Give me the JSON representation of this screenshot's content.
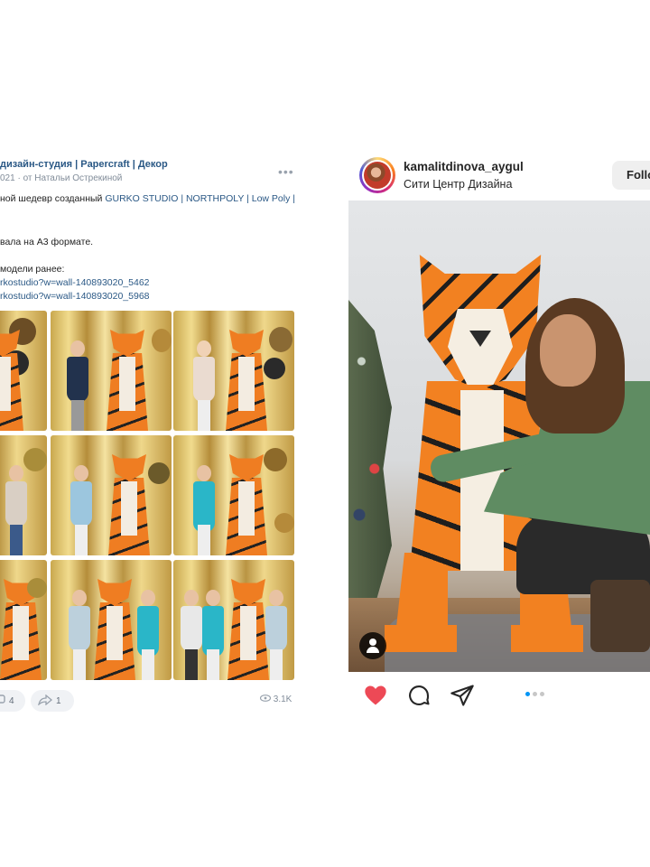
{
  "vk_post": {
    "title": "дизайн-студия | Papercraft | Декор",
    "subtitle": "021 · от Натальи Острекиной",
    "text_line1_prefix": "ной шедевр созданный ",
    "text_line1_link": "GURKO STUDIO | NORTHPOLY | Low Poly |",
    "text_line2": "вала на А3 формате.",
    "text_line3": "модели ранее:",
    "link1": "rkostudio?w=wall-140893020_5462",
    "link2": "rkostudio?w=wall-140893020_5968",
    "comments_count": "4",
    "shares_count": "1",
    "views": "3.1K",
    "icons": {
      "more": "more-dots-icon",
      "comment": "comment-icon",
      "share": "share-icon",
      "views": "eye-icon"
    }
  },
  "instagram_post": {
    "username": "kamalitdinova_aygul",
    "location": "Сити Центр Дизайна",
    "follow_label": "Follow",
    "carousel_total": 3,
    "carousel_active": 1,
    "colors": {
      "like": "#ed4956",
      "dot_active": "#0095f6"
    },
    "icons": {
      "like": "heart-icon",
      "comment": "comment-bubble-icon",
      "share": "send-icon",
      "tag": "user-tag-icon"
    }
  }
}
